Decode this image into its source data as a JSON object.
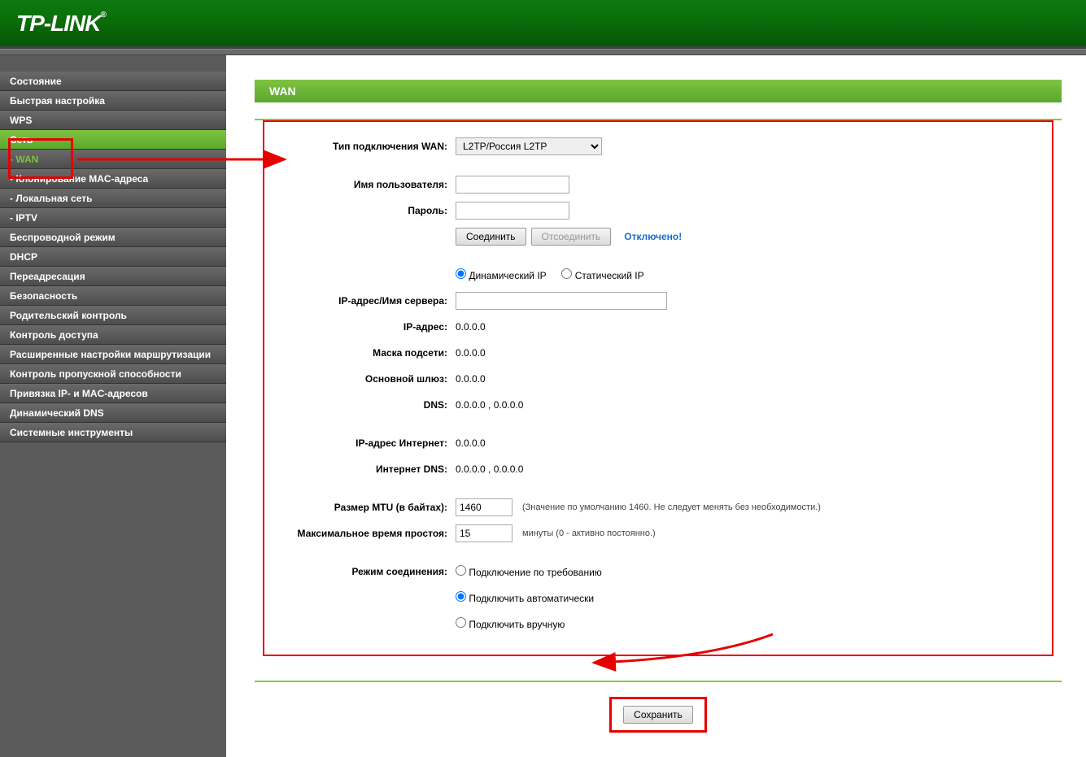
{
  "header": {
    "brand": "TP-LINK"
  },
  "sidebar": {
    "items": [
      {
        "label": "Состояние"
      },
      {
        "label": "Быстрая настройка"
      },
      {
        "label": "WPS"
      },
      {
        "label": "Сеть",
        "active": true
      },
      {
        "label": "- WAN",
        "subActive": true
      },
      {
        "label": "- Клонирование MAC-адреса"
      },
      {
        "label": "- Локальная сеть"
      },
      {
        "label": "- IPTV"
      },
      {
        "label": "Беспроводной режим"
      },
      {
        "label": "DHCP"
      },
      {
        "label": "Переадресация"
      },
      {
        "label": "Безопасность"
      },
      {
        "label": "Родительский контроль"
      },
      {
        "label": "Контроль доступа"
      },
      {
        "label": "Расширенные настройки маршрутизации"
      },
      {
        "label": "Контроль пропускной способности"
      },
      {
        "label": "Привязка IP- и MAC-адресов"
      },
      {
        "label": "Динамический DNS"
      },
      {
        "label": "Системные инструменты"
      }
    ]
  },
  "page": {
    "title": "WAN"
  },
  "form": {
    "wan_type_label": "Тип подключения WAN:",
    "wan_type_value": "L2TP/Россия L2TP",
    "username_label": "Имя пользователя:",
    "username_value": "",
    "password_label": "Пароль:",
    "password_value": "",
    "connect_btn": "Соединить",
    "disconnect_btn": "Отсоединить",
    "status": "Отключено!",
    "ip_mode_dynamic": "Динамический IP",
    "ip_mode_static": "Статический IP",
    "server_label": "IP-адрес/Имя сервера:",
    "server_value": "",
    "ip_label": "IP-адрес:",
    "ip_value": "0.0.0.0",
    "mask_label": "Маска подсети:",
    "mask_value": "0.0.0.0",
    "gateway_label": "Основной шлюз:",
    "gateway_value": "0.0.0.0",
    "dns_label": "DNS:",
    "dns_value": "0.0.0.0 , 0.0.0.0",
    "inet_ip_label": "IP-адрес Интернет:",
    "inet_ip_value": "0.0.0.0",
    "inet_dns_label": "Интернет DNS:",
    "inet_dns_value": "0.0.0.0 , 0.0.0.0",
    "mtu_label": "Размер MTU (в байтах):",
    "mtu_value": "1460",
    "mtu_hint": "(Значение по умолчанию 1460. Не следует менять без необходимости.)",
    "idle_label": "Максимальное время простоя:",
    "idle_value": "15",
    "idle_hint": "минуты (0 - активно постоянно.)",
    "conn_mode_label": "Режим соединения:",
    "conn_mode_ondemand": "Подключение по требованию",
    "conn_mode_auto": "Подключить автоматически",
    "conn_mode_manual": "Подключить вручную",
    "save_btn": "Сохранить"
  }
}
